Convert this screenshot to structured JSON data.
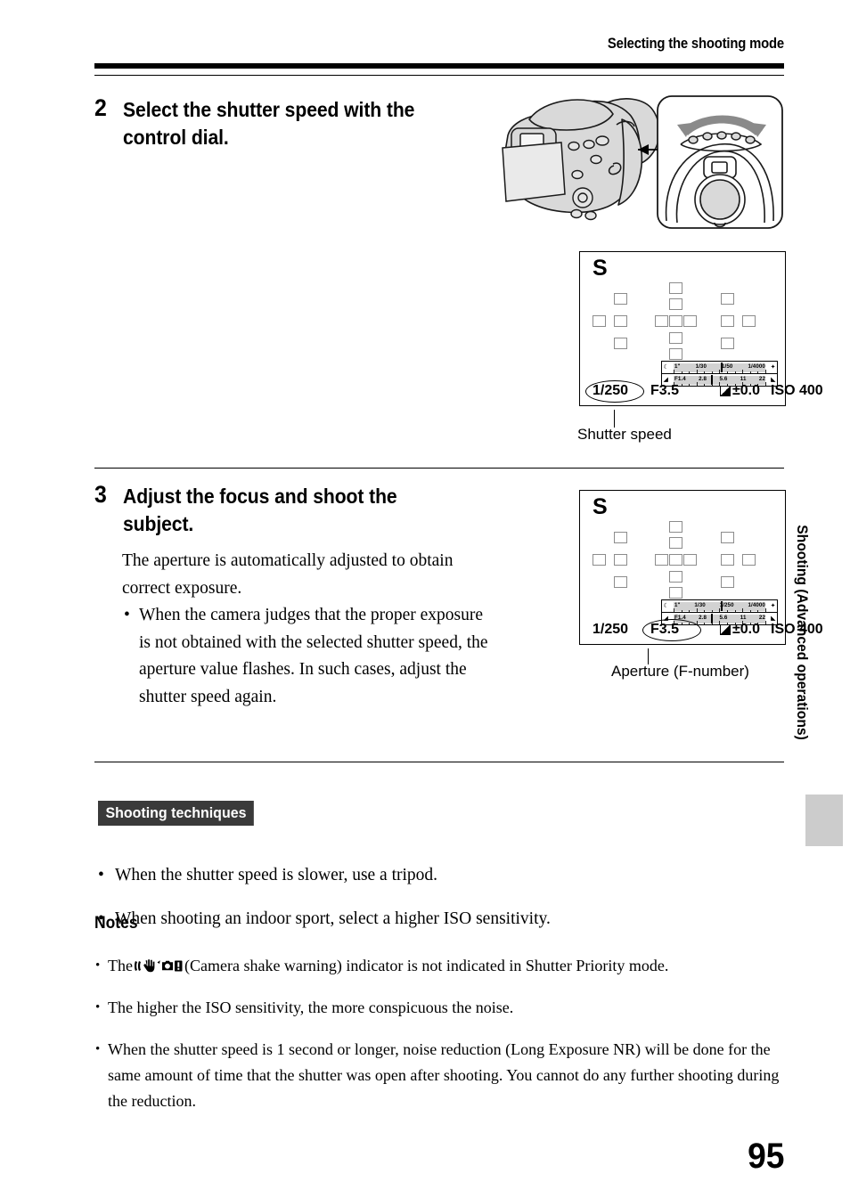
{
  "header": {
    "running_title": "Selecting the shooting mode"
  },
  "steps": [
    {
      "number": "2",
      "heading": "Select the shutter speed with the control dial.",
      "body": []
    },
    {
      "number": "3",
      "heading": "Adjust the focus and shoot the subject.",
      "body": [
        "The aperture is automatically adjusted to obtain correct exposure.",
        "When the camera judges that the proper exposure is not obtained with the selected shutter speed, the aperture value flashes. In such cases, adjust the shutter speed again."
      ]
    }
  ],
  "lcd_top": {
    "mode": "S",
    "shutter_speed": "1/250",
    "aperture": "F3.5",
    "exposure_comp": "±0.0",
    "iso": "ISO 400",
    "shutter_scale": {
      "left_icon": "person-icon",
      "right_icon": "runner-icon",
      "labels": [
        "1\"",
        "1/30",
        "1/50",
        "1/4000"
      ]
    },
    "aperture_scale": {
      "left_icon": "blur-near-icon",
      "right_icon": "blur-far-icon",
      "labels": [
        "F1.4",
        "2.8",
        "5.6",
        "11",
        "22"
      ]
    },
    "highlight": "shutter_speed",
    "caption": "Shutter speed"
  },
  "lcd_bottom": {
    "mode": "S",
    "shutter_speed": "1/250",
    "aperture": "F3.5",
    "exposure_comp": "±0.0",
    "iso": "ISO 400",
    "shutter_scale": {
      "left_icon": "person-icon",
      "right_icon": "runner-icon",
      "labels": [
        "1\"",
        "1/30",
        "1/250",
        "1/4000"
      ]
    },
    "aperture_scale": {
      "left_icon": "blur-near-icon",
      "right_icon": "blur-far-icon",
      "labels": [
        "F1.4",
        "2.8",
        "5.6",
        "11",
        "22"
      ]
    },
    "highlight": "aperture",
    "caption": "Aperture (F-number)"
  },
  "techniques": {
    "badge": "Shooting techniques",
    "items": [
      "When the shutter speed is slower, use a tripod.",
      "When shooting an indoor sport, select a higher ISO sensitivity."
    ]
  },
  "notes": {
    "title": "Notes",
    "items": [
      {
        "before": "The",
        "icon": "camera-shake-warning-icon",
        "after": "(Camera shake warning) indicator is not indicated in Shutter Priority mode."
      },
      {
        "before": "",
        "icon": "",
        "after": "The higher the ISO sensitivity, the more conspicuous the noise."
      },
      {
        "before": "",
        "icon": "",
        "after": "When the shutter speed is 1 second or longer, noise reduction (Long Exposure NR) will be done for the same amount of time that the shutter was open after shooting. You cannot do any further shooting during the reduction."
      }
    ]
  },
  "side_tab": {
    "label": "Shooting (Advanced operations)"
  },
  "page_number": "95",
  "colors": {
    "badge_bg": "#3a3a3a",
    "tab_mark": "#cccccc",
    "af_point": "#8c8c8c",
    "scale_band": "#d2d2d2"
  }
}
